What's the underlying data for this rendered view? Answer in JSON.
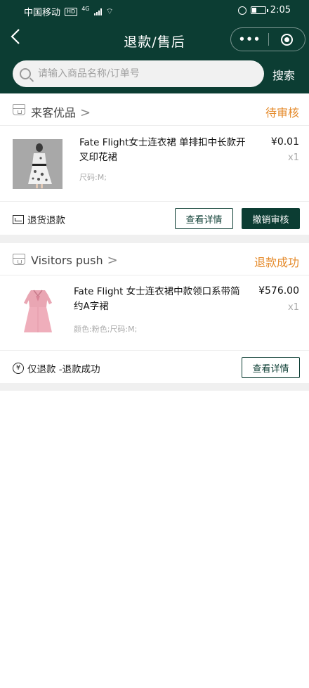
{
  "status_bar": {
    "carrier": "中国移动",
    "hd": "HD",
    "network": "4G",
    "time": "2:05",
    "battery_level": 0.35
  },
  "nav": {
    "title": "退款/售后",
    "more": "•••"
  },
  "search": {
    "placeholder": "请输入商品名称/订单号",
    "button": "搜索"
  },
  "orders": [
    {
      "store": "来客优品",
      "status": "待审核",
      "product_title": "Fate Flight女士连衣裙 单排扣中长款开叉印花裙",
      "spec": "尺码:M;",
      "price": "¥0.01",
      "qty": "x1",
      "type_label": "退货退款",
      "buttons": [
        "查看详情",
        "撤销审核"
      ]
    },
    {
      "store": "Visitors push",
      "status": "退款成功",
      "product_title": "Fate Flight 女士连衣裙中款领口系带简约A字裙",
      "spec": "颜色:粉色;尺码:M;",
      "price": "¥576.00",
      "qty": "x1",
      "type_label": "仅退款 -退款成功",
      "buttons": [
        "查看详情"
      ]
    }
  ],
  "colors": {
    "brand": "#0c3d33",
    "status": "#e58b2c",
    "divider": "#f0f0f0"
  }
}
